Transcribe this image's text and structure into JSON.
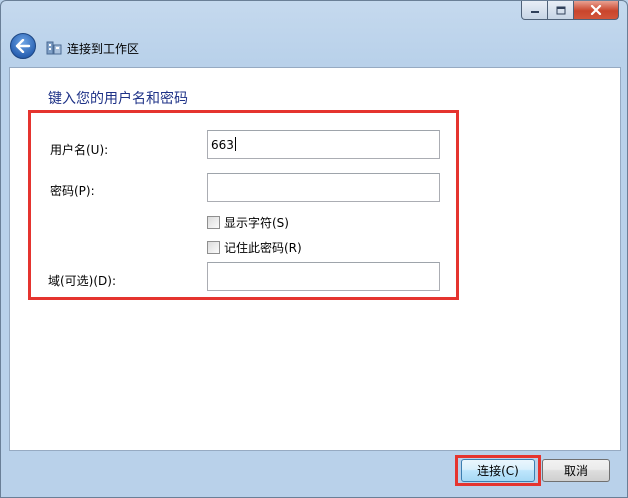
{
  "window": {
    "title": "连接到工作区",
    "caption_buttons": [
      "minimize-icon",
      "maximize-icon",
      "close-icon"
    ]
  },
  "form": {
    "heading": "键入您的用户名和密码",
    "username_label": "用户名(U):",
    "username_value": "663",
    "password_label": "密码(P):",
    "password_value": "",
    "show_chars_label": "显示字符(S)",
    "show_chars_checked": false,
    "remember_label": "记住此密码(R)",
    "remember_checked": false,
    "domain_label": "域(可选)(D):",
    "domain_value": ""
  },
  "buttons": {
    "connect_label": "连接(C)",
    "cancel_label": "取消"
  },
  "colors": {
    "highlight": "#e5342f",
    "heading": "#1e3287",
    "frame": "#b9d1ea"
  }
}
